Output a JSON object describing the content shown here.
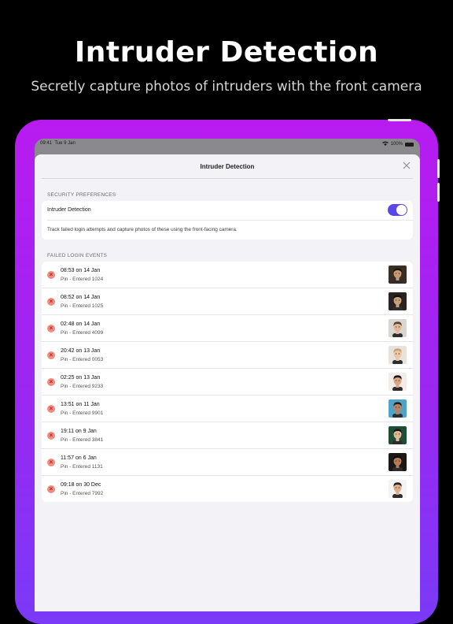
{
  "hero": {
    "title": "Intruder Detection",
    "subtitle": "Secretly capture photos of intruders with the front camera"
  },
  "status_bar": {
    "time": "09:41",
    "date": "Tue 9 Jan",
    "battery": "100%"
  },
  "sheet": {
    "title": "Intruder Detection",
    "close_icon": "close-icon"
  },
  "security": {
    "section_label": "SECURITY PREFERENCES",
    "toggle_label": "Intruder Detection",
    "toggle_on": true,
    "description": "Track failed login attempts and capture photos of these using the front-facing camera."
  },
  "failed": {
    "section_label": "FAILED LOGIN EVENTS",
    "events": [
      {
        "time": "08:53 on 14 Jan",
        "desc": "Pin - Entered 1024",
        "bg": "#3a2d22",
        "skin": "#c79a74",
        "hair": "#1c1410"
      },
      {
        "time": "08:52 on 14 Jan",
        "desc": "Pin - Entered 1025",
        "bg": "#2a2220",
        "skin": "#c8a07c",
        "hair": "#15100d"
      },
      {
        "time": "02:48 on 14 Jan",
        "desc": "Pin - Entered 4099",
        "bg": "#d9d6d2",
        "skin": "#e0b899",
        "hair": "#5b3e2b"
      },
      {
        "time": "20:42 on 13 Jan",
        "desc": "Pin - Entered 0053",
        "bg": "#e8e2dc",
        "skin": "#ebc5a5",
        "hair": "#c9a071"
      },
      {
        "time": "02:25 on 13 Jan",
        "desc": "Pin - Entered 9233",
        "bg": "#f2ede8",
        "skin": "#d9a883",
        "hair": "#1b1412"
      },
      {
        "time": "13:51 on 11 Jan",
        "desc": "Pin - Entered 9901",
        "bg": "#4fa3c9",
        "skin": "#b98361",
        "hair": "#2b1c14"
      },
      {
        "time": "19:11 on 9 Jan",
        "desc": "Pin - Entered 3841",
        "bg": "#1f4d36",
        "skin": "#e1b896",
        "hair": "#1b1311"
      },
      {
        "time": "11:57 on 6 Jan",
        "desc": "Pin - Entered 1131",
        "bg": "#1c1816",
        "skin": "#b37c57",
        "hair": "#0f0b09"
      },
      {
        "time": "09:18 on 30 Dec",
        "desc": "Pin - Entered 7992",
        "bg": "#f4f4f4",
        "skin": "#dcae8c",
        "hair": "#2a1d16"
      }
    ]
  }
}
